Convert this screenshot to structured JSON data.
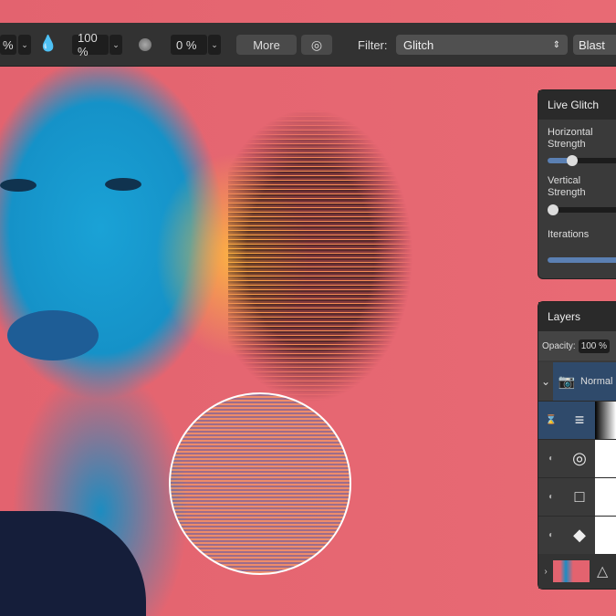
{
  "toolbar": {
    "width_value": "%",
    "opacity_value": "100 %",
    "hardness_value": "0 %",
    "more_label": "More",
    "filter_label": "Filter:",
    "filter_value": "Glitch",
    "mode_value": "Blast"
  },
  "live_glitch": {
    "title": "Live Glitch",
    "params": [
      {
        "label": "Horizontal Strength",
        "value": 0.36
      },
      {
        "label": "Vertical Strength",
        "value": 0.0
      },
      {
        "label": "Iterations",
        "value": 1.0
      }
    ]
  },
  "layers": {
    "title": "Layers",
    "opacity_label": "Opacity:",
    "opacity_value": "100 %",
    "blend_value": "Normal",
    "rows": [
      {
        "icon": "glitch-filter-icon"
      },
      {
        "icon": "lens-filter-icon"
      },
      {
        "icon": "curves-icon"
      },
      {
        "icon": "diamond-icon"
      }
    ]
  },
  "colors": {
    "accent": "#5b80b3",
    "background": "#e3636f"
  }
}
